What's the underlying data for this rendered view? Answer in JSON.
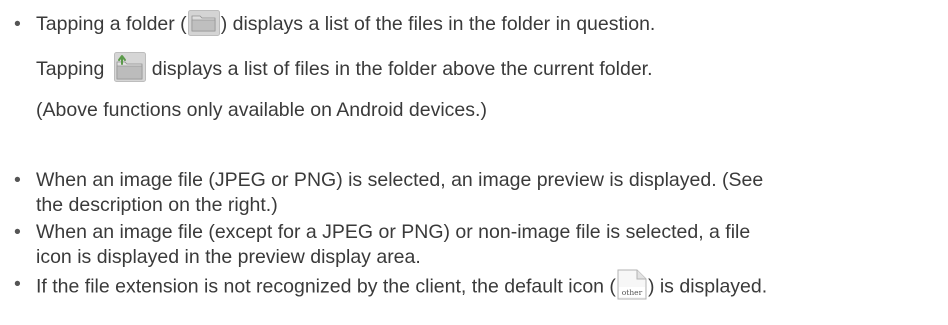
{
  "paragraphs": {
    "folder_tap": {
      "before": "Tapping a folder (",
      "after": ") displays a list of the files in the folder in question."
    },
    "folder_up": {
      "before": "Tapping ",
      "after": "displays a list of files in the folder above the current folder."
    },
    "android_note": "(Above functions only available on Android devices.)",
    "image_preview": {
      "line1": "When an image file (JPEG or PNG) is selected, an image preview is displayed. (See",
      "line2": "the description on the right.)"
    },
    "file_icon": {
      "line1": "When an image file (except for a JPEG or PNG) or non-image file is selected, a file",
      "line2": "icon is displayed in the preview display area."
    },
    "default_icon": {
      "before": "If the file extension is not recognized by the client, the default icon (",
      "after": ") is displayed."
    }
  },
  "bullet_char": "•",
  "icons": {
    "folder": "folder-icon",
    "folder_up": "folder-up-icon",
    "default_file": "default-file-icon",
    "default_file_label": "other"
  },
  "colors": {
    "text": "#3a3a3a",
    "icon_gray": "#b9b9b9",
    "arrow_green": "#5b9a4a"
  }
}
